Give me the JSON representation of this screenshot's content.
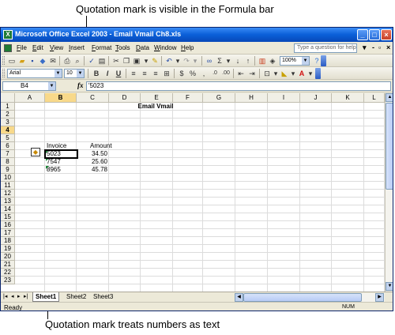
{
  "callouts": {
    "top": "Quotation mark is visible in the Formula bar",
    "bottom": "Quotation mark treats numbers as text"
  },
  "window": {
    "title": "Microsoft Office Excel 2003 - Email Vmail Ch8.xls"
  },
  "menu": {
    "items": [
      {
        "hot": "F",
        "rest": "ile"
      },
      {
        "hot": "E",
        "rest": "dit"
      },
      {
        "hot": "V",
        "rest": "iew"
      },
      {
        "hot": "I",
        "rest": "nsert"
      },
      {
        "hot": "F",
        "rest": "ormat"
      },
      {
        "hot": "T",
        "rest": "ools"
      },
      {
        "hot": "D",
        "rest": "ata"
      },
      {
        "hot": "W",
        "rest": "indow"
      },
      {
        "hot": "H",
        "rest": "elp"
      }
    ],
    "help_placeholder": "Type a question for help"
  },
  "toolbar": {
    "zoom": "100%",
    "font_name": "Arial",
    "font_size": "10",
    "bold": "B",
    "italic": "I",
    "underline": "U",
    "currency": "$",
    "percent": "%",
    "sum": "Σ"
  },
  "formula_bar": {
    "name_box": "B4",
    "fx": "fx",
    "value": "'5023"
  },
  "sheet": {
    "columns": [
      "A",
      "B",
      "C",
      "D",
      "E",
      "F",
      "G",
      "H",
      "I",
      "J",
      "K",
      "L"
    ],
    "selected_column": "B",
    "rows": [
      "1",
      "2",
      "3",
      "4",
      "5",
      "6",
      "7",
      "8",
      "9",
      "10",
      "11",
      "12",
      "13",
      "14",
      "15",
      "16",
      "17",
      "18",
      "19",
      "20",
      "21",
      "22",
      "23"
    ],
    "selected_row": "4",
    "title": "Email Vmail",
    "header_invoice": "Invoice",
    "header_amount": "Amount",
    "data": [
      {
        "invoice": "5023",
        "amount": "34.50"
      },
      {
        "invoice": "7547",
        "amount": "25.60"
      },
      {
        "invoice": "8965",
        "amount": "45.78"
      }
    ]
  },
  "tabs": {
    "sheets": [
      "Sheet1",
      "Sheet2",
      "Sheet3"
    ],
    "active": "Sheet1"
  },
  "status": {
    "ready": "Ready",
    "num": "NUM"
  }
}
